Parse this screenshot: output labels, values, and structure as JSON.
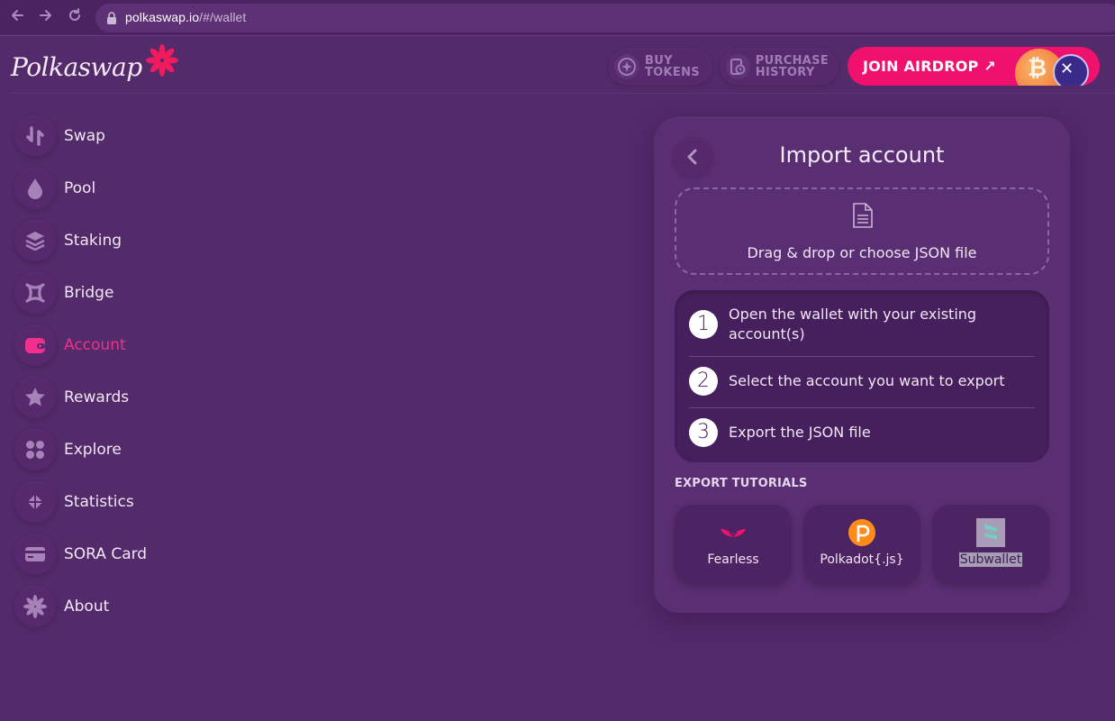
{
  "browser": {
    "url_host": "polkaswap.io",
    "url_path": "/#/wallet",
    "icons": [
      "back-arrow-icon",
      "forward-arrow-icon",
      "reload-icon",
      "lock-icon"
    ]
  },
  "header": {
    "logo_text": "Polkaswap",
    "buy_tokens": "BUY\nTOKENS",
    "purchase_history": "PURCHASE\nHISTORY",
    "airdrop": "JOIN AIRDROP ↗",
    "accent_color": "#f0116f"
  },
  "sidebar": {
    "items": [
      {
        "label": "Swap",
        "icon": "swap-icon"
      },
      {
        "label": "Pool",
        "icon": "drop-icon"
      },
      {
        "label": "Staking",
        "icon": "layers-icon"
      },
      {
        "label": "Bridge",
        "icon": "bridge-icon"
      },
      {
        "label": "Account",
        "icon": "wallet-icon",
        "active": true
      },
      {
        "label": "Rewards",
        "icon": "star-icon"
      },
      {
        "label": "Explore",
        "icon": "grid-icon"
      },
      {
        "label": "Statistics",
        "icon": "statistics-icon"
      },
      {
        "label": "SORA Card",
        "icon": "card-icon"
      },
      {
        "label": "About",
        "icon": "flower-icon"
      }
    ]
  },
  "panel": {
    "title": "Import account",
    "dropzone_text": "Drag & drop or choose JSON file",
    "steps": [
      {
        "num": "1",
        "text": "Open the wallet with your existing account(s)"
      },
      {
        "num": "2",
        "text": "Select the account you want to export"
      },
      {
        "num": "3",
        "text": "Export the JSON file"
      }
    ],
    "tutorials_title": "EXPORT TUTORIALS",
    "tutorials": [
      {
        "label": "Fearless",
        "icon": "fearless-icon"
      },
      {
        "label": "Polkadot{.js}",
        "icon": "polkadot-icon"
      },
      {
        "label": "Subwallet",
        "icon": "subwallet-icon"
      }
    ]
  }
}
